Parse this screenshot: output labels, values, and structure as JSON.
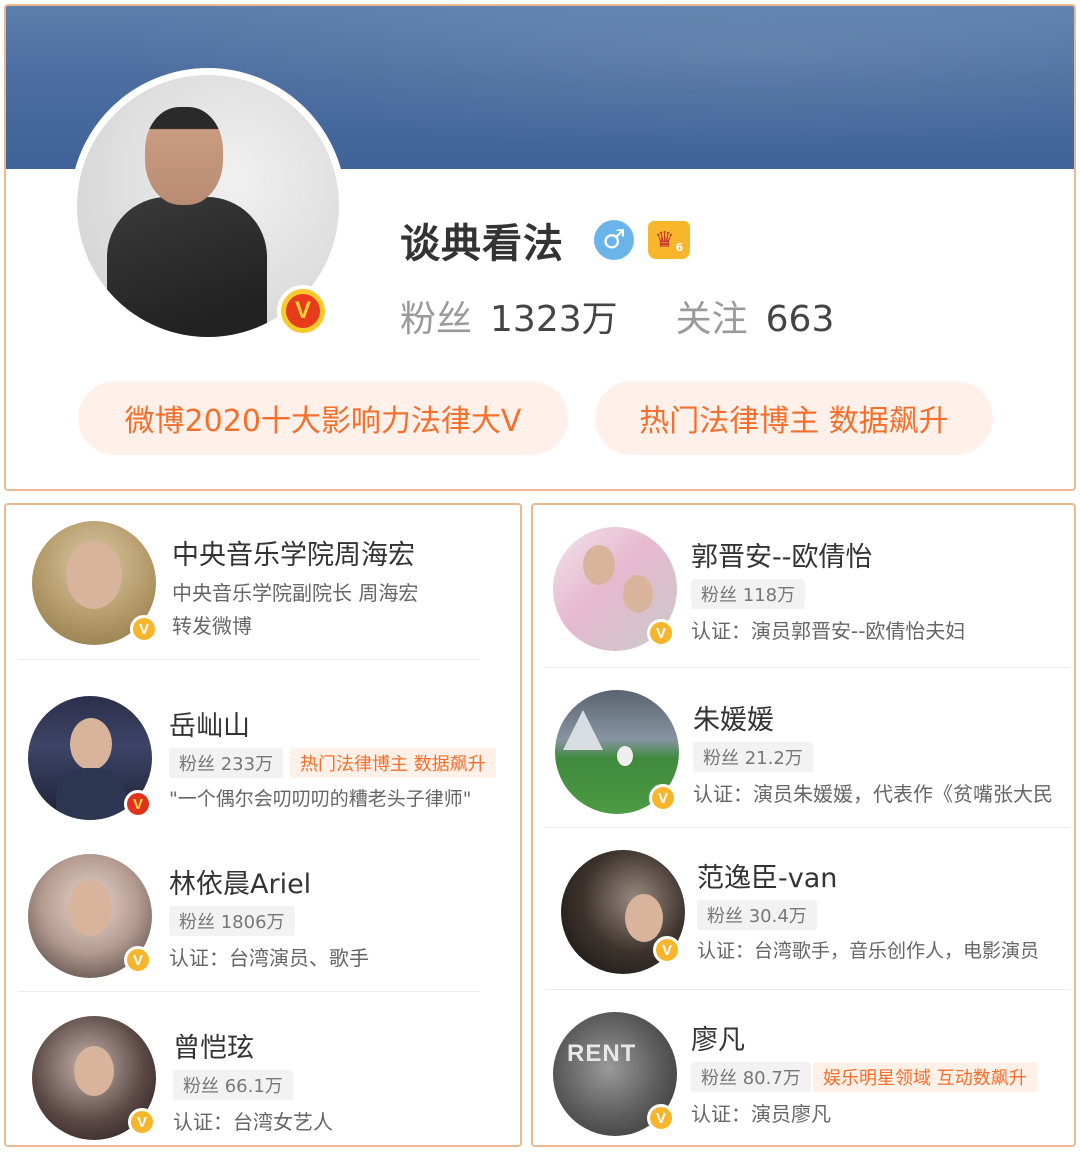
{
  "profile": {
    "name": "谈典看法",
    "gender_icon": "male-icon",
    "vip_icon": "vip-crown-icon",
    "vip_level": "6",
    "verified_badge": "V",
    "fans_label": "粉丝",
    "fans_value": "1323万",
    "following_label": "关注",
    "following_value": "663",
    "honors": [
      "微博2020十大影响力法律大V",
      "热门法律博主 数据飙升"
    ]
  },
  "left_list": [
    {
      "name": "中央音乐学院周海宏",
      "desc1": "中央音乐学院副院长 周海宏",
      "desc2": "转发微博",
      "badge": "V",
      "badge_color": "#f7b52c"
    },
    {
      "name": "岳屾山",
      "fans": "粉丝 233万",
      "tag": "热门法律博主 数据飙升",
      "desc": "\"一个偶尔会叨叨叨的糟老头子律师\"",
      "badge": "V",
      "badge_color": "#e3321c"
    },
    {
      "name": "林依晨Ariel",
      "fans": "粉丝 1806万",
      "desc": "认证：台湾演员、歌手",
      "badge": "V",
      "badge_color": "#f7b52c"
    },
    {
      "name": "曾恺玹",
      "fans": "粉丝 66.1万",
      "desc": "认证：台湾女艺人",
      "badge": "V",
      "badge_color": "#f7b52c"
    }
  ],
  "right_list": [
    {
      "name": "郭晋安--欧倩怡",
      "fans": "粉丝 118万",
      "desc": "认证：演员郭晋安--欧倩怡夫妇",
      "badge": "V"
    },
    {
      "name": "朱媛媛",
      "fans": "粉丝 21.2万",
      "desc": "认证：演员朱媛媛，代表作《贫嘴张大民",
      "badge": "V"
    },
    {
      "name": "范逸臣-van",
      "fans": "粉丝 30.4万",
      "desc": "认证：台湾歌手，音乐创作人，电影演员",
      "badge": "V"
    },
    {
      "name": "廖凡",
      "fans": "粉丝 80.7万",
      "tag": "娱乐明星领域 互动数飙升",
      "desc": "认证：演员廖凡",
      "badge": "V"
    }
  ]
}
